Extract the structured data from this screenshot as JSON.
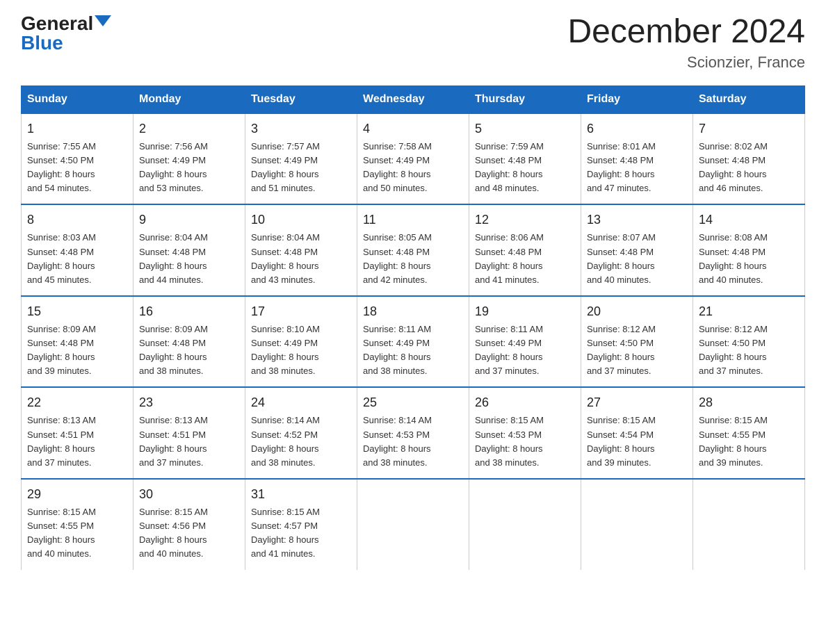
{
  "header": {
    "logo_general": "General",
    "logo_blue": "Blue",
    "month_title": "December 2024",
    "location": "Scionzier, France"
  },
  "days_of_week": [
    "Sunday",
    "Monday",
    "Tuesday",
    "Wednesday",
    "Thursday",
    "Friday",
    "Saturday"
  ],
  "weeks": [
    [
      {
        "day": "1",
        "sunrise": "7:55 AM",
        "sunset": "4:50 PM",
        "daylight": "8 hours and 54 minutes."
      },
      {
        "day": "2",
        "sunrise": "7:56 AM",
        "sunset": "4:49 PM",
        "daylight": "8 hours and 53 minutes."
      },
      {
        "day": "3",
        "sunrise": "7:57 AM",
        "sunset": "4:49 PM",
        "daylight": "8 hours and 51 minutes."
      },
      {
        "day": "4",
        "sunrise": "7:58 AM",
        "sunset": "4:49 PM",
        "daylight": "8 hours and 50 minutes."
      },
      {
        "day": "5",
        "sunrise": "7:59 AM",
        "sunset": "4:48 PM",
        "daylight": "8 hours and 48 minutes."
      },
      {
        "day": "6",
        "sunrise": "8:01 AM",
        "sunset": "4:48 PM",
        "daylight": "8 hours and 47 minutes."
      },
      {
        "day": "7",
        "sunrise": "8:02 AM",
        "sunset": "4:48 PM",
        "daylight": "8 hours and 46 minutes."
      }
    ],
    [
      {
        "day": "8",
        "sunrise": "8:03 AM",
        "sunset": "4:48 PM",
        "daylight": "8 hours and 45 minutes."
      },
      {
        "day": "9",
        "sunrise": "8:04 AM",
        "sunset": "4:48 PM",
        "daylight": "8 hours and 44 minutes."
      },
      {
        "day": "10",
        "sunrise": "8:04 AM",
        "sunset": "4:48 PM",
        "daylight": "8 hours and 43 minutes."
      },
      {
        "day": "11",
        "sunrise": "8:05 AM",
        "sunset": "4:48 PM",
        "daylight": "8 hours and 42 minutes."
      },
      {
        "day": "12",
        "sunrise": "8:06 AM",
        "sunset": "4:48 PM",
        "daylight": "8 hours and 41 minutes."
      },
      {
        "day": "13",
        "sunrise": "8:07 AM",
        "sunset": "4:48 PM",
        "daylight": "8 hours and 40 minutes."
      },
      {
        "day": "14",
        "sunrise": "8:08 AM",
        "sunset": "4:48 PM",
        "daylight": "8 hours and 40 minutes."
      }
    ],
    [
      {
        "day": "15",
        "sunrise": "8:09 AM",
        "sunset": "4:48 PM",
        "daylight": "8 hours and 39 minutes."
      },
      {
        "day": "16",
        "sunrise": "8:09 AM",
        "sunset": "4:48 PM",
        "daylight": "8 hours and 38 minutes."
      },
      {
        "day": "17",
        "sunrise": "8:10 AM",
        "sunset": "4:49 PM",
        "daylight": "8 hours and 38 minutes."
      },
      {
        "day": "18",
        "sunrise": "8:11 AM",
        "sunset": "4:49 PM",
        "daylight": "8 hours and 38 minutes."
      },
      {
        "day": "19",
        "sunrise": "8:11 AM",
        "sunset": "4:49 PM",
        "daylight": "8 hours and 37 minutes."
      },
      {
        "day": "20",
        "sunrise": "8:12 AM",
        "sunset": "4:50 PM",
        "daylight": "8 hours and 37 minutes."
      },
      {
        "day": "21",
        "sunrise": "8:12 AM",
        "sunset": "4:50 PM",
        "daylight": "8 hours and 37 minutes."
      }
    ],
    [
      {
        "day": "22",
        "sunrise": "8:13 AM",
        "sunset": "4:51 PM",
        "daylight": "8 hours and 37 minutes."
      },
      {
        "day": "23",
        "sunrise": "8:13 AM",
        "sunset": "4:51 PM",
        "daylight": "8 hours and 37 minutes."
      },
      {
        "day": "24",
        "sunrise": "8:14 AM",
        "sunset": "4:52 PM",
        "daylight": "8 hours and 38 minutes."
      },
      {
        "day": "25",
        "sunrise": "8:14 AM",
        "sunset": "4:53 PM",
        "daylight": "8 hours and 38 minutes."
      },
      {
        "day": "26",
        "sunrise": "8:15 AM",
        "sunset": "4:53 PM",
        "daylight": "8 hours and 38 minutes."
      },
      {
        "day": "27",
        "sunrise": "8:15 AM",
        "sunset": "4:54 PM",
        "daylight": "8 hours and 39 minutes."
      },
      {
        "day": "28",
        "sunrise": "8:15 AM",
        "sunset": "4:55 PM",
        "daylight": "8 hours and 39 minutes."
      }
    ],
    [
      {
        "day": "29",
        "sunrise": "8:15 AM",
        "sunset": "4:55 PM",
        "daylight": "8 hours and 40 minutes."
      },
      {
        "day": "30",
        "sunrise": "8:15 AM",
        "sunset": "4:56 PM",
        "daylight": "8 hours and 40 minutes."
      },
      {
        "day": "31",
        "sunrise": "8:15 AM",
        "sunset": "4:57 PM",
        "daylight": "8 hours and 41 minutes."
      },
      null,
      null,
      null,
      null
    ]
  ],
  "labels": {
    "sunrise": "Sunrise:",
    "sunset": "Sunset:",
    "daylight": "Daylight:"
  }
}
